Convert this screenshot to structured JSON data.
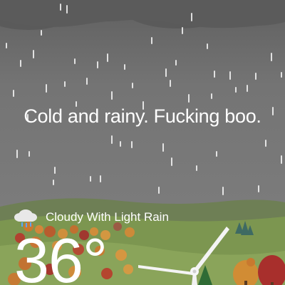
{
  "weather": {
    "headline": "Cold and rainy. Fucking boo.",
    "condition": "Cloudy With Light Rain",
    "temperature": "36°",
    "condition_icon": "cloud-rain-icon"
  },
  "colors": {
    "sky": "#6f6f6f",
    "cloud": "#5d5d5d",
    "hills": "#6b8a49",
    "rain": "#ffffff",
    "text": "#ffffff"
  }
}
